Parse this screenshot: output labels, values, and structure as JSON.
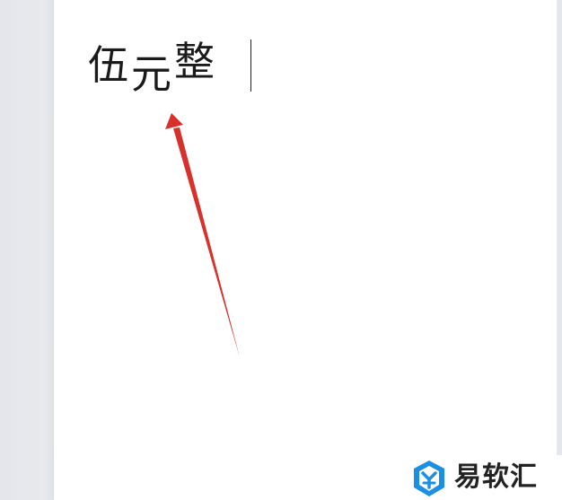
{
  "document": {
    "text_chars": [
      "伍",
      "元",
      "整"
    ]
  },
  "watermark": {
    "text": "易软汇",
    "logo_icon": "yiruanhui-logo-icon",
    "logo_color": "#1a8fe3"
  },
  "annotation": {
    "arrow_icon": "red-arrow-icon",
    "arrow_color": "#d8302a"
  },
  "colors": {
    "canvas_background": "#e6e8ec",
    "page_background": "#ffffff",
    "text": "#1a1a1a"
  }
}
